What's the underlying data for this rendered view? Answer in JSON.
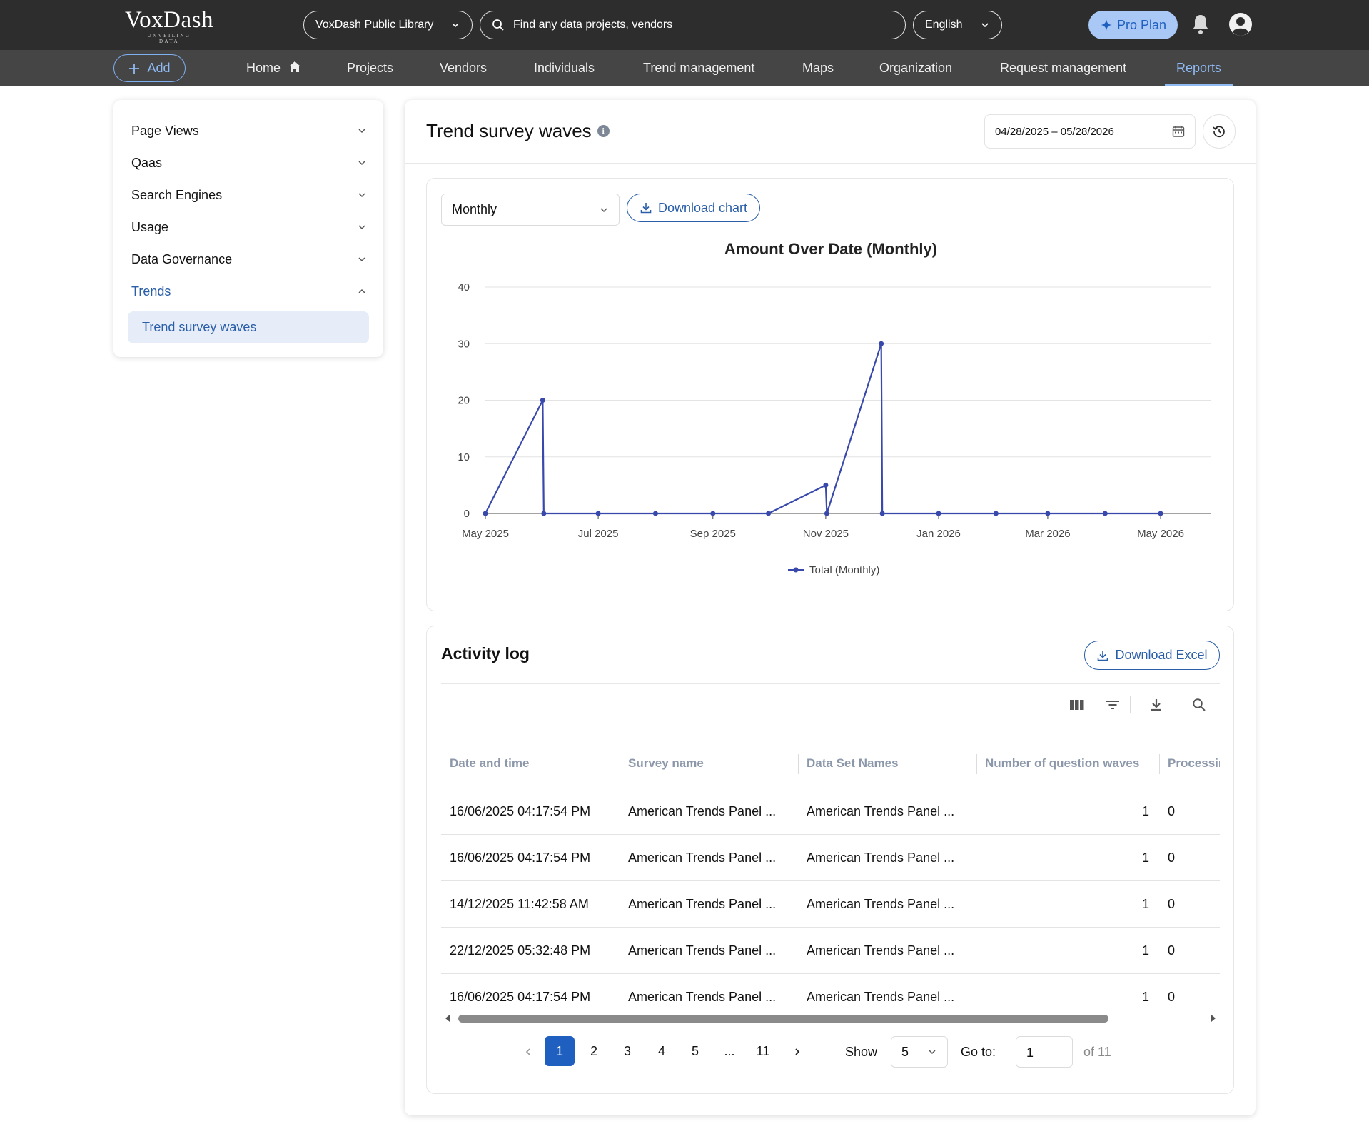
{
  "app": {
    "logo": {
      "name": "VoxDash",
      "tagline": "UNVEILING DATA"
    },
    "library_select": "VoxDash Public Library",
    "search_placeholder": "Find any data projects, vendors",
    "language": "English",
    "pro_plan": "Pro Plan"
  },
  "nav": {
    "add": "Add",
    "items": [
      "Home",
      "Projects",
      "Vendors",
      "Individuals",
      "Trend management",
      "Maps",
      "Organization",
      "Request management",
      "Reports"
    ],
    "active": "Reports"
  },
  "sidebar": {
    "items": [
      "Page Views",
      "Qaas",
      "Search Engines",
      "Usage",
      "Data Governance",
      "Trends"
    ],
    "open_item": "Trends",
    "sub_item": "Trend survey waves"
  },
  "page": {
    "title": "Trend survey waves",
    "date_range": "04/28/2025 – 05/28/2026"
  },
  "chart_controls": {
    "period": "Monthly",
    "download_label": "Download chart"
  },
  "chart_data": {
    "type": "line",
    "title": "Amount Over Date (Monthly)",
    "xlabel": "",
    "ylabel": "",
    "ylim": [
      0,
      40
    ],
    "yticks": [
      "0",
      "10",
      "20",
      "30",
      "40"
    ],
    "xticks": [
      "May 2025",
      "Jul 2025",
      "Sep 2025",
      "Nov 2025",
      "Jan 2026",
      "Mar 2026",
      "May 2026"
    ],
    "xrange": [
      "2025-05-01",
      "2026-05-28"
    ],
    "grid": true,
    "legend_position": "bottom",
    "color": "#3949ab",
    "series": [
      {
        "name": "Total (Monthly)",
        "points": [
          {
            "x": "2025-05-01",
            "y": 0
          },
          {
            "x": "2025-06-01",
            "y": 20
          },
          {
            "x": "2025-06-01",
            "y": 0
          },
          {
            "x": "2025-07-01",
            "y": 0
          },
          {
            "x": "2025-08-01",
            "y": 0
          },
          {
            "x": "2025-09-01",
            "y": 0
          },
          {
            "x": "2025-10-01",
            "y": 0
          },
          {
            "x": "2025-11-01",
            "y": 5
          },
          {
            "x": "2025-11-01",
            "y": 0
          },
          {
            "x": "2025-12-01",
            "y": 30
          },
          {
            "x": "2025-12-01",
            "y": 0
          },
          {
            "x": "2026-01-01",
            "y": 0
          },
          {
            "x": "2026-02-01",
            "y": 0
          },
          {
            "x": "2026-03-01",
            "y": 0
          },
          {
            "x": "2026-04-01",
            "y": 0
          },
          {
            "x": "2026-05-01",
            "y": 0
          }
        ]
      }
    ]
  },
  "activity": {
    "title": "Activity log",
    "download_label": "Download Excel",
    "columns": [
      "Date and time",
      "Survey name",
      "Data Set Names",
      "Number of question waves",
      "Processir"
    ],
    "rows": [
      [
        "16/06/2025 04:17:54 PM",
        "American Trends Panel ...",
        "American Trends Panel ...",
        "1",
        "0"
      ],
      [
        "16/06/2025 04:17:54 PM",
        "American Trends Panel ...",
        "American Trends Panel ...",
        "1",
        "0"
      ],
      [
        "14/12/2025 11:42:58 AM",
        "American Trends Panel ...",
        "American Trends Panel ...",
        "1",
        "0"
      ],
      [
        "22/12/2025 05:32:48 PM",
        "American Trends Panel ...",
        "American Trends Panel ...",
        "1",
        "0"
      ],
      [
        "16/06/2025 04:17:54 PM",
        "American Trends Panel ...",
        "American Trends Panel ...",
        "1",
        "0"
      ]
    ]
  },
  "pagination": {
    "pages": [
      "1",
      "2",
      "3",
      "4",
      "5",
      "...",
      "11"
    ],
    "current": "1",
    "show_label": "Show",
    "page_size": "5",
    "goto_label": "Go to:",
    "goto_value": "1",
    "of_label": "of 11"
  }
}
